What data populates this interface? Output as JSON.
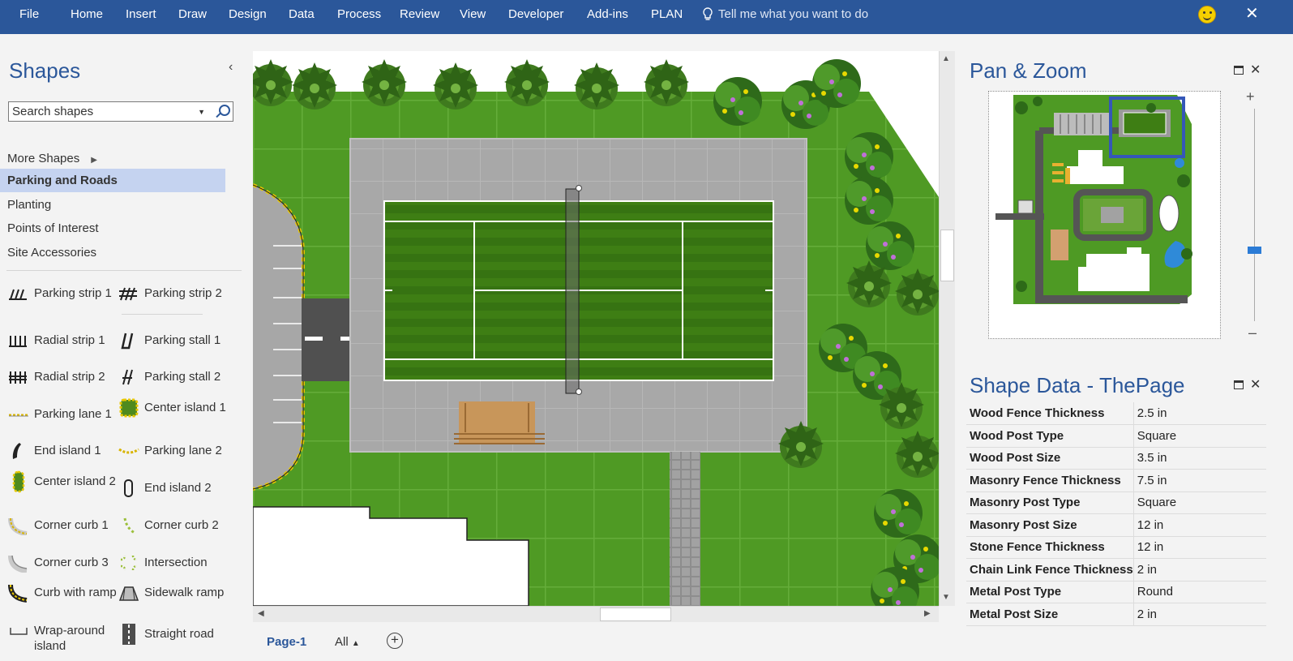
{
  "ribbon": {
    "tabs": [
      "File",
      "Home",
      "Insert",
      "Draw",
      "Design",
      "Data",
      "Process",
      "Review",
      "View",
      "Developer",
      "Add-ins",
      "PLAN"
    ],
    "tell_me": "Tell me what you want to do"
  },
  "shapes_panel": {
    "title": "Shapes",
    "search_placeholder": "Search shapes",
    "more_shapes": "More Shapes",
    "stencils": [
      "Parking and Roads",
      "Planting",
      "Points of Interest",
      "Site Accessories"
    ],
    "masters": [
      [
        "Parking strip 1",
        "Parking strip 2"
      ],
      [
        "Radial strip 1",
        "Parking stall 1"
      ],
      [
        "Radial strip 2",
        "Parking stall 2"
      ],
      [
        "Parking lane 1",
        "Center island 1"
      ],
      [
        "End island 1",
        "Parking lane 2"
      ],
      [
        "Center island 2",
        "End island 2"
      ],
      [
        "Corner curb 1",
        "Corner curb 2"
      ],
      [
        "Corner curb 3",
        "Intersection"
      ],
      [
        "Curb with ramp",
        "Sidewalk ramp"
      ],
      [
        "Wrap-around island",
        "Straight road"
      ]
    ]
  },
  "page_tabs": {
    "active": "Page-1",
    "all": "All"
  },
  "pan_zoom": {
    "title": "Pan & Zoom"
  },
  "shape_data": {
    "title": "Shape Data - ThePage",
    "rows": [
      [
        "Wood Fence Thickness",
        "2.5 in"
      ],
      [
        "Wood Post Type",
        "Square"
      ],
      [
        "Wood Post Size",
        "3.5 in"
      ],
      [
        "Masonry Fence Thickness",
        "7.5 in"
      ],
      [
        "Masonry Post Type",
        "Square"
      ],
      [
        "Masonry Post Size",
        "12 in"
      ],
      [
        "Stone Fence Thickness",
        "12 in"
      ],
      [
        "Chain Link Fence Thickness",
        "2 in"
      ],
      [
        "Metal Post Type",
        "Round"
      ],
      [
        "Metal Post Size",
        "2 in"
      ]
    ]
  },
  "colors": {
    "ribbon": "#2b579a",
    "accent": "#2b579a",
    "selected_stencil": "#c5d3f0",
    "grass": "#4e9a24",
    "court": "#3d7d14",
    "pavement": "#a9a9a9"
  }
}
